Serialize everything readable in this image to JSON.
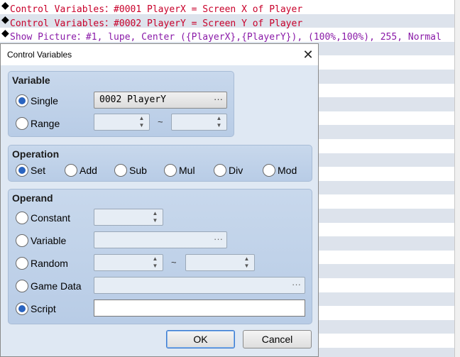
{
  "event_list": {
    "rows": [
      {
        "text": "Control Variables：#0001 PlayerX = Screen X of Player",
        "color": "#c8002a"
      },
      {
        "text": "Control Variables：#0002 PlayerY = Screen Y of Player",
        "color": "#c8002a"
      },
      {
        "text": "Show Picture：#1, lupe, Center ({PlayerX},{PlayerY}), (100%,100%), 255, Normal",
        "color": "#8a1aa8"
      }
    ],
    "marker": "◆"
  },
  "dialog": {
    "title": "Control Variables",
    "close_glyph": "✕",
    "variable": {
      "heading": "Variable",
      "single_label": "Single",
      "single_value": "0002 PlayerY",
      "range_label": "Range",
      "selected": "single"
    },
    "operation": {
      "heading": "Operation",
      "options": [
        "Set",
        "Add",
        "Sub",
        "Mul",
        "Div",
        "Mod"
      ],
      "selected": "Set"
    },
    "operand": {
      "heading": "Operand",
      "constant_label": "Constant",
      "variable_label": "Variable",
      "random_label": "Random",
      "game_data_label": "Game Data",
      "script_label": "Script",
      "script_value": "",
      "selected": "Script"
    },
    "ok_label": "OK",
    "cancel_label": "Cancel",
    "ellipsis": "···",
    "tilde": "~"
  },
  "colors": {
    "accent_radio": "#2a64c0",
    "command_red": "#c8002a",
    "command_purple": "#8a1aa8",
    "group_fill": "#c0d2ea"
  }
}
